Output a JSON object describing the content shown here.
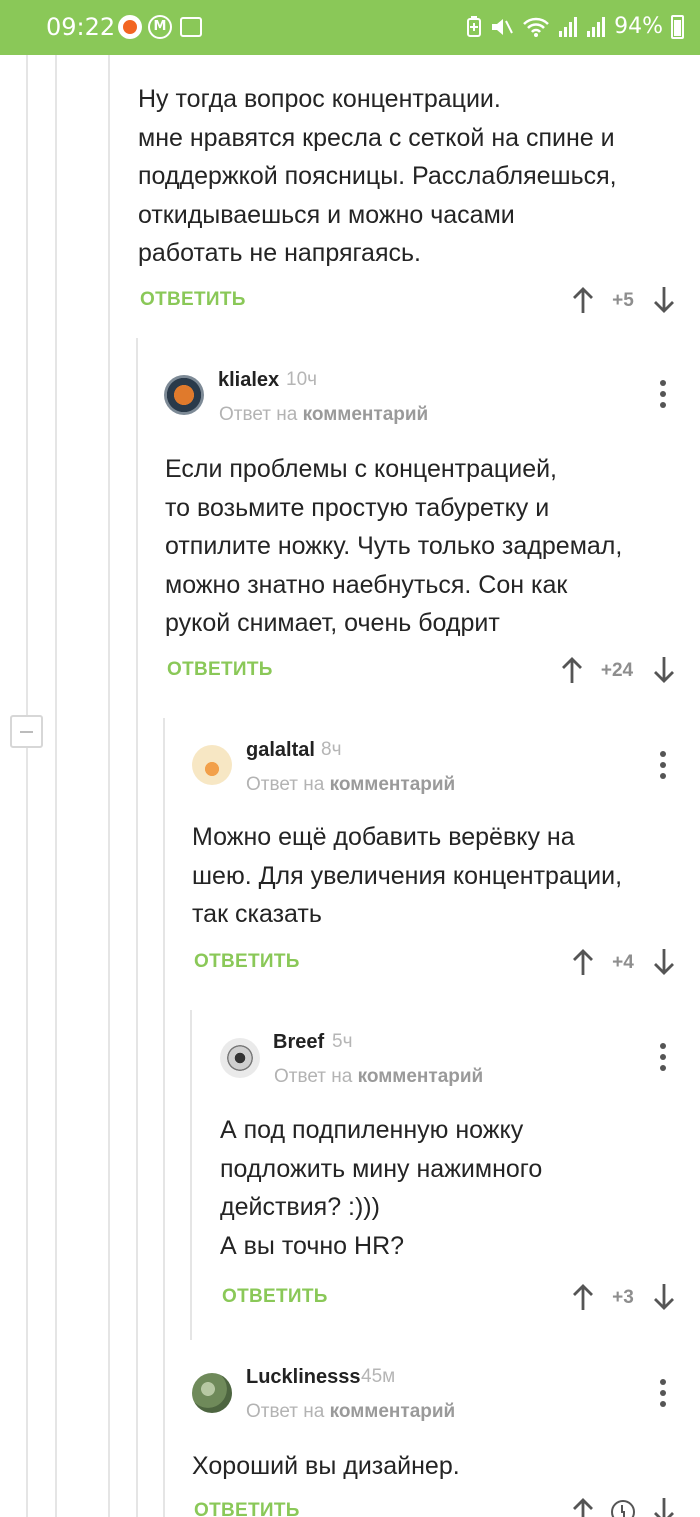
{
  "status_bar": {
    "time": "09:22",
    "battery": "94%",
    "metro_label": "M",
    "icons": [
      "mi-icon",
      "metro-icon",
      "gallery-icon",
      "battery-saver-icon",
      "mute-icon",
      "wifi-icon",
      "signal-icon",
      "signal-icon",
      "battery-icon"
    ]
  },
  "comments": [
    {
      "text": "Ну тогда вопрос концентрации.\nмне нравятся кресла с сеткой на спине и\nподдержкой поясницы. Расслабляешься,\nоткидываешься и можно часами\nработать не напрягаясь.",
      "reply_label": "ОТВЕТИТЬ",
      "votes": "+5"
    },
    {
      "user": "klialex",
      "time": "10ч",
      "reply_prefix": "Ответ на",
      "reply_target": "комментарий",
      "text": "Если проблемы с концентрацией,\nто возьмите простую табуретку и\nотпилите ножку. Чуть только задремал,\nможно знатно наебнуться. Сон как\nрукой снимает, очень бодрит",
      "reply_label": "ОТВЕТИТЬ",
      "votes": "+24"
    },
    {
      "user": "galaltal",
      "time": "8ч",
      "reply_prefix": "Ответ на",
      "reply_target": "комментарий",
      "text": "Можно ещё добавить верёвку на\nшею. Для увеличения концентрации,\nтак сказать",
      "reply_label": "ОТВЕТИТЬ",
      "votes": "+4"
    },
    {
      "user": "Breef",
      "time": "5ч",
      "reply_prefix": "Ответ на",
      "reply_target": "комментарий",
      "text": "А под подпиленную ножку\nподложить мину нажимного\nдействия? :)))\nА вы точно HR?",
      "reply_label": "ОТВЕТИТЬ",
      "votes": "+3"
    },
    {
      "user": "Lucklinesss",
      "time": "45м",
      "reply_prefix": "Ответ на",
      "reply_target": "комментарий",
      "text": "Хороший вы дизайнер.",
      "reply_label": "ОТВЕТИТЬ",
      "votes": ""
    }
  ],
  "colors": {
    "accent": "#8ac858",
    "thread_line": "#e5e5e5",
    "muted_text": "#b3b3b3"
  }
}
